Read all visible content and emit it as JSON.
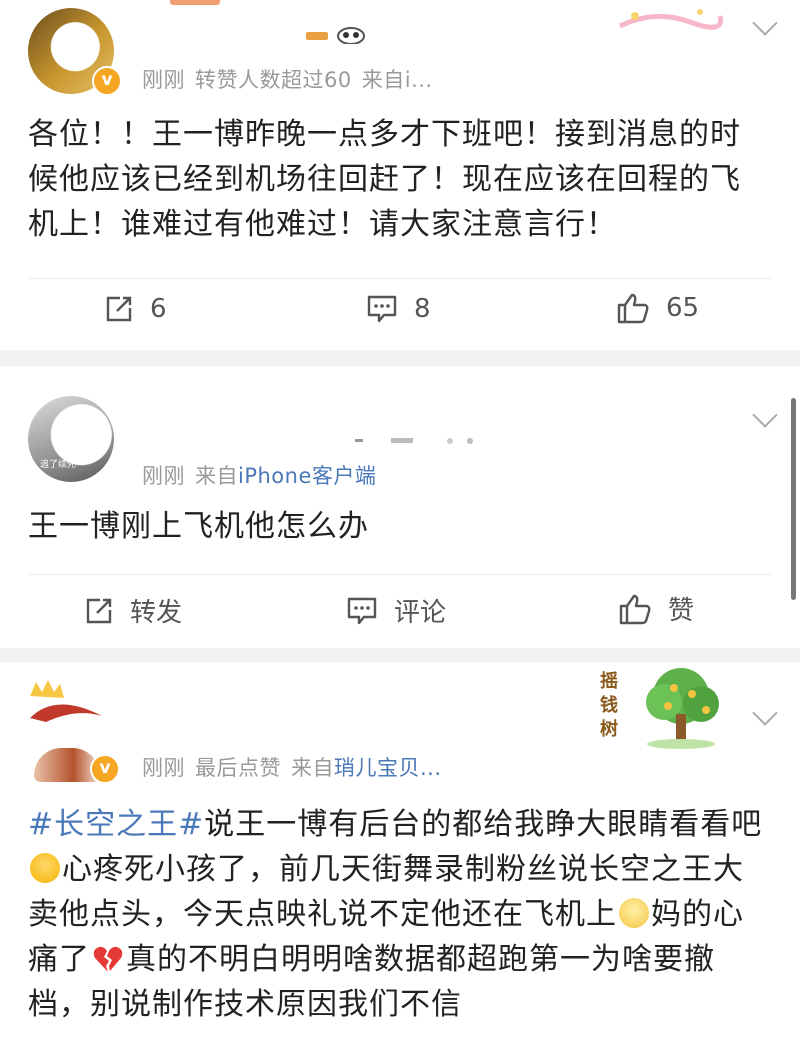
{
  "posts": [
    {
      "meta": {
        "time": "刚刚",
        "extra": "转赞人数超过60",
        "source_label": "来自",
        "source": "i..."
      },
      "text": "各位！！王一博昨晚一点多才下班吧！接到消息的时候他应该已经到机场往回赶了！现在应该在回程的飞机上！谁难过有他难过！请大家注意言行！",
      "actions": {
        "repost": "6",
        "comment": "8",
        "like": "65"
      }
    },
    {
      "meta": {
        "time": "刚刚",
        "source_label": "来自",
        "source": "iPhone客户端"
      },
      "avatar_text": "追了续死",
      "text": "王一博刚上飞机他怎么办",
      "actions": {
        "repost": "转发",
        "comment": "评论",
        "like": "赞"
      }
    },
    {
      "meta": {
        "time": "刚刚",
        "extra": "最后点赞",
        "source_label": "来自",
        "source": "琑儿宝贝..."
      },
      "hashtag": "#长空之王#",
      "text_1": "说王一博有后台的都给我睁大眼睛看看吧",
      "text_2": "心疼死小孩了，前几天街舞录制粉丝说长空之王大卖他点头，今天点映礼说不定他还在飞机上",
      "text_3": "妈的心痛了",
      "text_4": "真的不明白明明啥数据都超跑第一为啥要撤档，别说制作技术原因我们不信",
      "deco_text": "摇钱树"
    }
  ],
  "colors": {
    "link": "#4a78b8",
    "meta": "#9a9a9a",
    "badge": "#f5a623",
    "background": "#f2f2f2"
  },
  "icons": [
    "repost-icon",
    "comment-icon",
    "like-icon",
    "chevron-down-icon",
    "verified-badge-icon"
  ]
}
